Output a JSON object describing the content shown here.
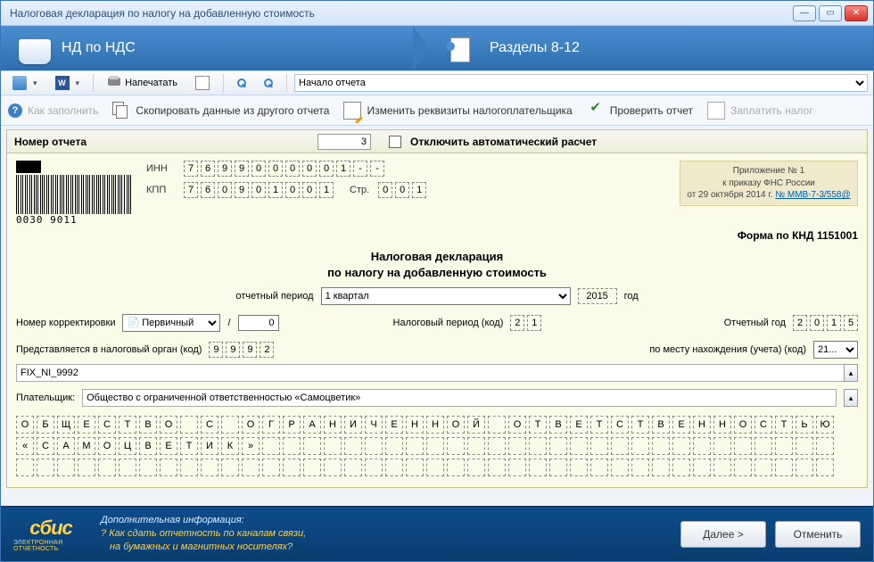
{
  "window": {
    "title": "Налоговая декларация по налогу на добавленную стоимость"
  },
  "ribbon": {
    "tab1": "НД по НДС",
    "tab2": "Разделы 8-12"
  },
  "toolbar1": {
    "print": "Напечатать",
    "start": "Начало отчета"
  },
  "toolbar2": {
    "how_dis": "Как заполнить",
    "copy": "Скопировать данные из другого отчета",
    "change": "Изменить реквизиты налогоплательщика",
    "check": "Проверить отчет",
    "pay_dis": "Заплатить налог"
  },
  "header": {
    "label": "Номер отчета",
    "value": "3",
    "chk_label": "Отключить автоматический расчет"
  },
  "ids": {
    "inn_label": "ИНН",
    "inn": [
      "7",
      "6",
      "9",
      "9",
      "0",
      "0",
      "0",
      "0",
      "0",
      "1",
      "-",
      "-"
    ],
    "kpp_label": "КПП",
    "kpp": [
      "7",
      "6",
      "0",
      "9",
      "0",
      "1",
      "0",
      "0",
      "1"
    ],
    "page_label": "Стр.",
    "page": [
      "0",
      "0",
      "1"
    ]
  },
  "barcode_num": "0030 9011",
  "appbox": {
    "l1": "Приложение № 1",
    "l2": "к приказу ФНС России",
    "l3_a": "от 29 октября 2014 г. ",
    "l3_b": "№ ММВ-7-3/558@"
  },
  "knd": "Форма по КНД 1151001",
  "titleblock": {
    "l1": "Налоговая декларация",
    "l2": "по налогу на добавленную стоимость"
  },
  "period": {
    "label": "отчетный период",
    "value": "1 квартал",
    "year": "2015",
    "year_lab": "год"
  },
  "corr": {
    "label": "Номер корректировки",
    "sel": "Первичный",
    "slash": "/",
    "num": "0",
    "taxper_label": "Налоговый период (код)",
    "taxper": [
      "2",
      "1"
    ],
    "repyear_label": "Отчетный год",
    "repyear": [
      "2",
      "0",
      "1",
      "5"
    ]
  },
  "organ": {
    "label": "Представляется в налоговый орган (код)",
    "code": [
      "9",
      "9",
      "9",
      "2"
    ],
    "place_label": "по месту нахождения (учета) (код)",
    "place_sel": "21..."
  },
  "fix": "FIX_NI_9992",
  "payer": {
    "label": "Плательщик:",
    "value": "Общество с ограниченной ответственностью «Самоцветик»"
  },
  "grid": {
    "r1": [
      "О",
      "Б",
      "Щ",
      "Е",
      "С",
      "Т",
      "В",
      "О",
      "",
      "С",
      "",
      "О",
      "Г",
      "Р",
      "А",
      "Н",
      "И",
      "Ч",
      "Е",
      "Н",
      "Н",
      "О",
      "Й",
      "",
      "О",
      "Т",
      "В",
      "Е",
      "Т",
      "С",
      "Т",
      "В",
      "Е",
      "Н",
      "Н",
      "О",
      "С",
      "Т",
      "Ь",
      "Ю"
    ],
    "r2": [
      "«",
      "С",
      "А",
      "М",
      "О",
      "Ц",
      "В",
      "Е",
      "Т",
      "И",
      "К",
      "»",
      "",
      "",
      "",
      "",
      "",
      "",
      "",
      "",
      "",
      "",
      "",
      "",
      "",
      "",
      "",
      "",
      "",
      "",
      "",
      "",
      "",
      "",
      "",
      "",
      "",
      "",
      "",
      ""
    ],
    "r3": [
      "",
      "",
      "",
      "",
      "",
      "",
      "",
      "",
      "",
      "",
      "",
      "",
      "",
      "",
      "",
      "",
      "",
      "",
      "",
      "",
      "",
      "",
      "",
      "",
      "",
      "",
      "",
      "",
      "",
      "",
      "",
      "",
      "",
      "",
      "",
      "",
      "",
      "",
      "",
      ""
    ]
  },
  "footer": {
    "brand": "сбис",
    "brand_sub": "ЭЛЕКТРОННАЯ ОТЧЕТНОСТЬ",
    "t": "Дополнительная информация:",
    "q1": "Как сдать отчетность по каналам связи,",
    "q2": "на бумажных и магнитных носителях?",
    "next": "Далее >",
    "cancel": "Отменить"
  }
}
